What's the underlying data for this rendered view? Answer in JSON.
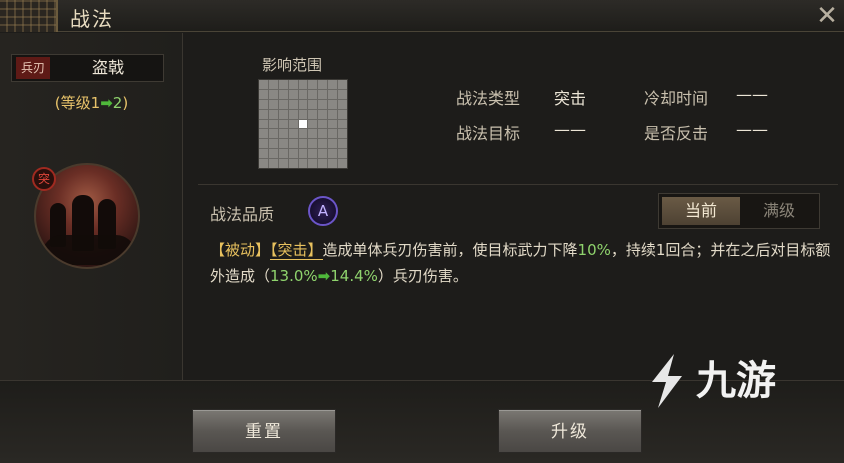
{
  "window": {
    "title": "战法",
    "close_icon": "close-icon"
  },
  "skill": {
    "type_badge": "兵刃",
    "name": "盗戟",
    "level_open": "(等级1",
    "level_to": "2",
    "level_close": ")"
  },
  "range": {
    "label": "影响范围",
    "grid_size": 9
  },
  "info": {
    "type_label": "战法类型",
    "type_value": "突击",
    "cooldown_label": "冷却时间",
    "cooldown_value": "——",
    "target_label": "战法目标",
    "target_value": "——",
    "counter_label": "是否反击",
    "counter_value": "——"
  },
  "quality": {
    "label": "战法品质",
    "grade": "A"
  },
  "toggle": {
    "current": "当前",
    "max": "满级"
  },
  "description": {
    "tag1": "【被动】",
    "tag2": "【突击】",
    "text1": "造成单体兵刃伤害前，使目标武力下降",
    "pct1": "10%",
    "text2": "，持续1回合；并在之后对目标额外造成（",
    "from": "13.0%",
    "to": "14.4%",
    "text3": "）兵刃伤害。"
  },
  "buttons": {
    "reset": "重置",
    "upgrade": "升级"
  },
  "watermark": {
    "text": "九游"
  },
  "colors": {
    "accent_gold": "#e8c15e",
    "accent_green": "#8fd36d",
    "badge_red": "#5e1a16",
    "grade_purple": "#6b55c8"
  }
}
